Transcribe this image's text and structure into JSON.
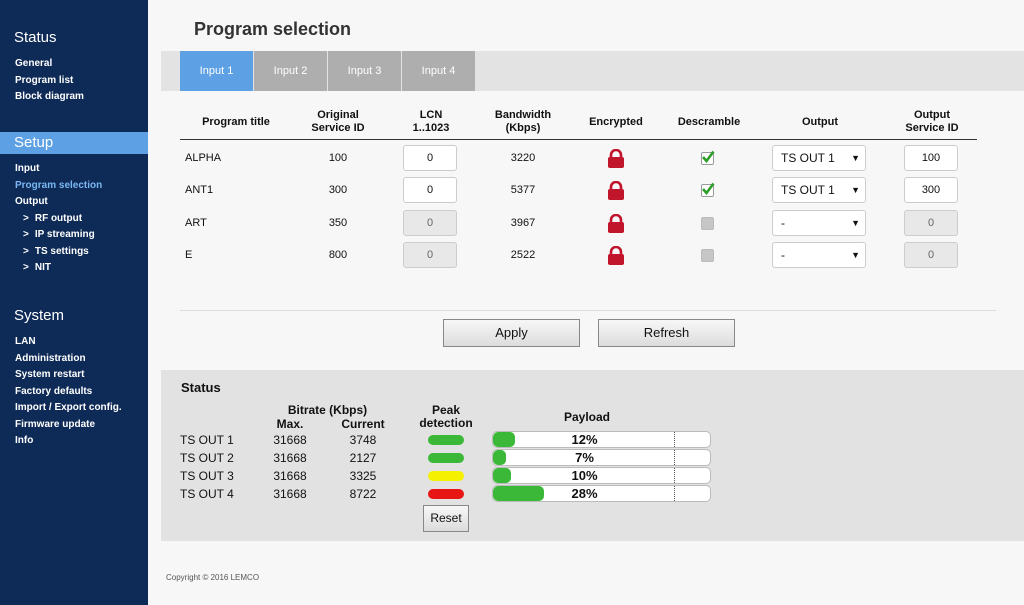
{
  "sidebar": {
    "status": {
      "heading": "Status",
      "items": [
        "General",
        "Program list",
        "Block diagram"
      ]
    },
    "setup": {
      "heading": "Setup",
      "items": [
        "Input",
        "Program selection",
        "Output",
        "RF output",
        "IP streaming",
        "TS settings",
        "NIT"
      ]
    },
    "system": {
      "heading": "System",
      "items": [
        "LAN",
        "Administration",
        "System restart",
        "Factory defaults",
        "Import / Export config.",
        "Firmware update",
        "Info"
      ]
    }
  },
  "page": {
    "title": "Program selection"
  },
  "tabs": [
    "Input 1",
    "Input 2",
    "Input 3",
    "Input 4"
  ],
  "program_table": {
    "headers": {
      "title": "Program title",
      "sid": [
        "Original",
        "Service ID"
      ],
      "lcn": [
        "LCN",
        "1..1023"
      ],
      "bw": [
        "Bandwidth",
        "(Kbps)"
      ],
      "enc": "Encrypted",
      "desc": "Descramble",
      "output": "Output",
      "osid": [
        "Output",
        "Service ID"
      ]
    },
    "rows": [
      {
        "title": "ALPHA",
        "sid": "100",
        "lcn": "0",
        "bw": "3220",
        "output": "TS OUT 1",
        "osid": "100",
        "descramble": true,
        "enabled": true
      },
      {
        "title": "ANT1",
        "sid": "300",
        "lcn": "0",
        "bw": "5377",
        "output": "TS OUT 1",
        "osid": "300",
        "descramble": true,
        "enabled": true
      },
      {
        "title": "ART",
        "sid": "350",
        "lcn": "0",
        "bw": "3967",
        "output": "-",
        "osid": "0",
        "descramble": false,
        "enabled": false
      },
      {
        "title": "E",
        "sid": "800",
        "lcn": "0",
        "bw": "2522",
        "output": "-",
        "osid": "0",
        "descramble": false,
        "enabled": false
      }
    ]
  },
  "buttons": {
    "apply": "Apply",
    "refresh": "Refresh",
    "reset": "Reset"
  },
  "status": {
    "title": "Status",
    "headers": {
      "bitrate": "Bitrate (Kbps)",
      "max": "Max.",
      "current": "Current",
      "peak": [
        "Peak",
        "detection"
      ],
      "payload": "Payload"
    },
    "rows": [
      {
        "name": "TS OUT 1",
        "max": "31668",
        "current": "3748",
        "peak_color": "#3cb838",
        "payload": 12,
        "payload_label": "12%"
      },
      {
        "name": "TS OUT 2",
        "max": "31668",
        "current": "2127",
        "peak_color": "#3cb838",
        "payload": 7,
        "payload_label": "7%"
      },
      {
        "name": "TS OUT 3",
        "max": "31668",
        "current": "3325",
        "peak_color": "#f5ef00",
        "payload": 10,
        "payload_label": "10%"
      },
      {
        "name": "TS OUT 4",
        "max": "31668",
        "current": "8722",
        "peak_color": "#e81515",
        "payload": 28,
        "payload_label": "28%"
      }
    ]
  },
  "footer": "Copyright © 2016 LEMCO",
  "colors": {
    "sidebar_bg": "#0e2a57",
    "accent": "#5da0e3",
    "lock_red": "#c0152b",
    "check_green": "#3cb838"
  },
  "icons": {
    "encrypted": "lock-icon",
    "descramble_on": "checkmark-icon",
    "dropdown": "chevron-down-icon"
  }
}
